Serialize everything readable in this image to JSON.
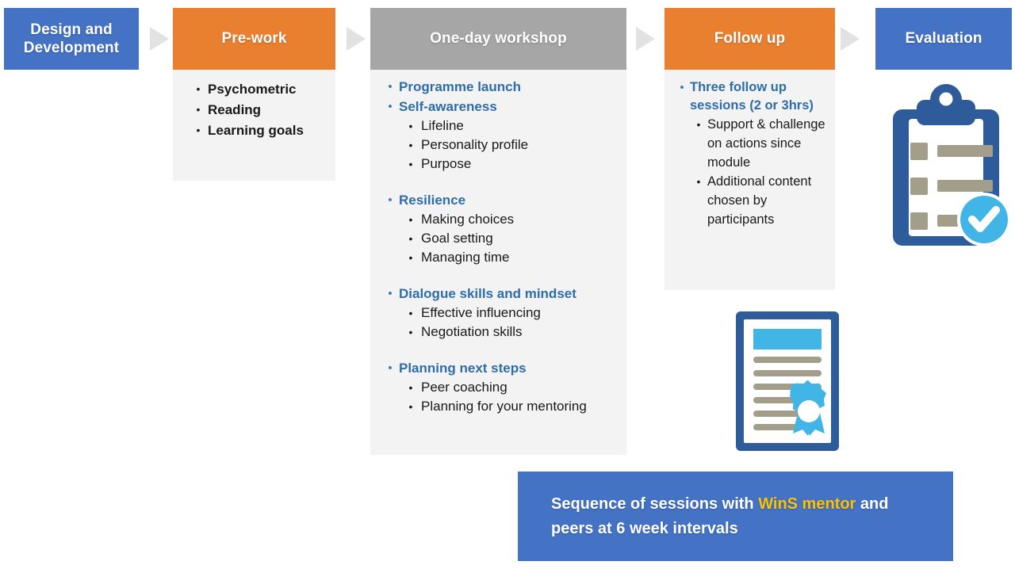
{
  "colors": {
    "blue": "#4472c4",
    "orange": "#e8802f",
    "gray": "#a6a6a6",
    "panel": "#f3f3f3",
    "heading_blue": "#2e6da8",
    "banner_blue": "#4472c4",
    "banner_highlight": "#ffc000",
    "arrow_gray": "#e2e2e2",
    "icon_dark_blue": "#2e5b9a",
    "icon_light_blue": "#41b6e6",
    "icon_khaki": "#a39e8a"
  },
  "phases": [
    {
      "id": "design-and-development",
      "title": "Design and\nDevelopment",
      "title_line1": "Design and",
      "title_line2": "Development",
      "header_color": "#4472c4",
      "items": []
    },
    {
      "id": "pre-work",
      "title": "Pre-work",
      "header_color": "#e8802f",
      "items": [
        {
          "label": "Psychometric"
        },
        {
          "label": "Reading"
        },
        {
          "label": "Learning goals"
        }
      ]
    },
    {
      "id": "one-day-workshop",
      "title": "One-day workshop",
      "header_color": "#a6a6a6",
      "groups": [
        {
          "headings": [
            {
              "label": "Programme launch",
              "children": []
            },
            {
              "label": "Self-awareness",
              "children": [
                {
                  "label": "Lifeline"
                },
                {
                  "label": "Personality profile"
                },
                {
                  "label": "Purpose"
                }
              ]
            }
          ]
        },
        {
          "headings": [
            {
              "label": "Resilience",
              "children": [
                {
                  "label": "Making choices"
                },
                {
                  "label": "Goal setting"
                },
                {
                  "label": "Managing time"
                }
              ]
            }
          ]
        },
        {
          "headings": [
            {
              "label": "Dialogue skills and mindset",
              "children": [
                {
                  "label": "Effective influencing"
                },
                {
                  "label": "Negotiation skills"
                }
              ]
            }
          ]
        },
        {
          "headings": [
            {
              "label": "Planning next steps",
              "children": [
                {
                  "label": "Peer coaching"
                },
                {
                  "label": "Planning for your mentoring"
                }
              ]
            }
          ]
        }
      ]
    },
    {
      "id": "follow-up",
      "title": "Follow up",
      "header_color": "#e8802f",
      "heading": "Three follow up sessions (2 or 3hrs)",
      "children": [
        {
          "label": "Support & challenge on actions since module"
        },
        {
          "label": "Additional content chosen by participants"
        }
      ]
    },
    {
      "id": "evaluation",
      "title": "Evaluation",
      "header_color": "#4472c4",
      "items": []
    }
  ],
  "arrows": [
    {
      "name": "arrow-design-to-prework"
    },
    {
      "name": "arrow-prework-to-workshop"
    },
    {
      "name": "arrow-workshop-to-followup"
    },
    {
      "name": "arrow-followup-to-evaluation"
    }
  ],
  "icons": {
    "clipboard_check": "clipboard-check-icon",
    "certificate": "certificate-icon"
  },
  "banner": {
    "text_part1": "Sequence of sessions with ",
    "highlight": "WinS mentor",
    "text_part2": " and peers at 6 week intervals",
    "full_text": "Sequence of sessions with WinS mentor and peers at 6 week intervals"
  }
}
